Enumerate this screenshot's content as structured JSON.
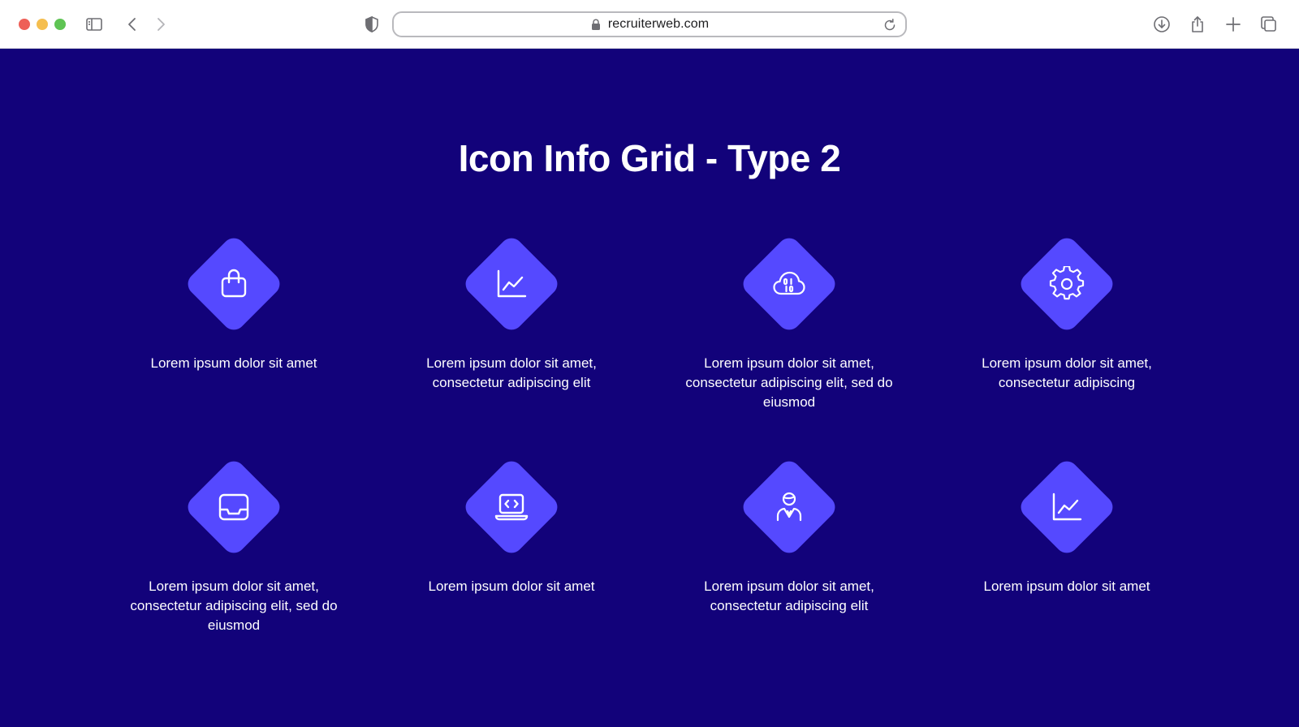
{
  "browser": {
    "url": "recruiterweb.com"
  },
  "page": {
    "title": "Icon Info Grid - Type 2",
    "colors": {
      "background": "#12027a",
      "tile": "#5549ff",
      "text": "#ffffff"
    }
  },
  "cards": [
    {
      "icon": "shopping-bag-icon",
      "text": "Lorem ipsum dolor sit amet"
    },
    {
      "icon": "line-chart-icon",
      "text": "Lorem ipsum dolor sit amet, consectetur adipiscing elit"
    },
    {
      "icon": "cloud-binary-icon",
      "text": "Lorem ipsum dolor sit amet, consectetur adipiscing elit, sed do eiusmod"
    },
    {
      "icon": "gear-icon",
      "text": "Lorem ipsum dolor sit amet, consectetur adipiscing"
    },
    {
      "icon": "inbox-tray-icon",
      "text": "Lorem ipsum dolor sit amet, consectetur adipiscing elit, sed do eiusmod"
    },
    {
      "icon": "laptop-code-icon",
      "text": "Lorem ipsum dolor sit amet"
    },
    {
      "icon": "businessman-icon",
      "text": "Lorem ipsum dolor sit amet, consectetur adipiscing elit"
    },
    {
      "icon": "line-chart-icon",
      "text": "Lorem ipsum dolor sit amet"
    }
  ]
}
